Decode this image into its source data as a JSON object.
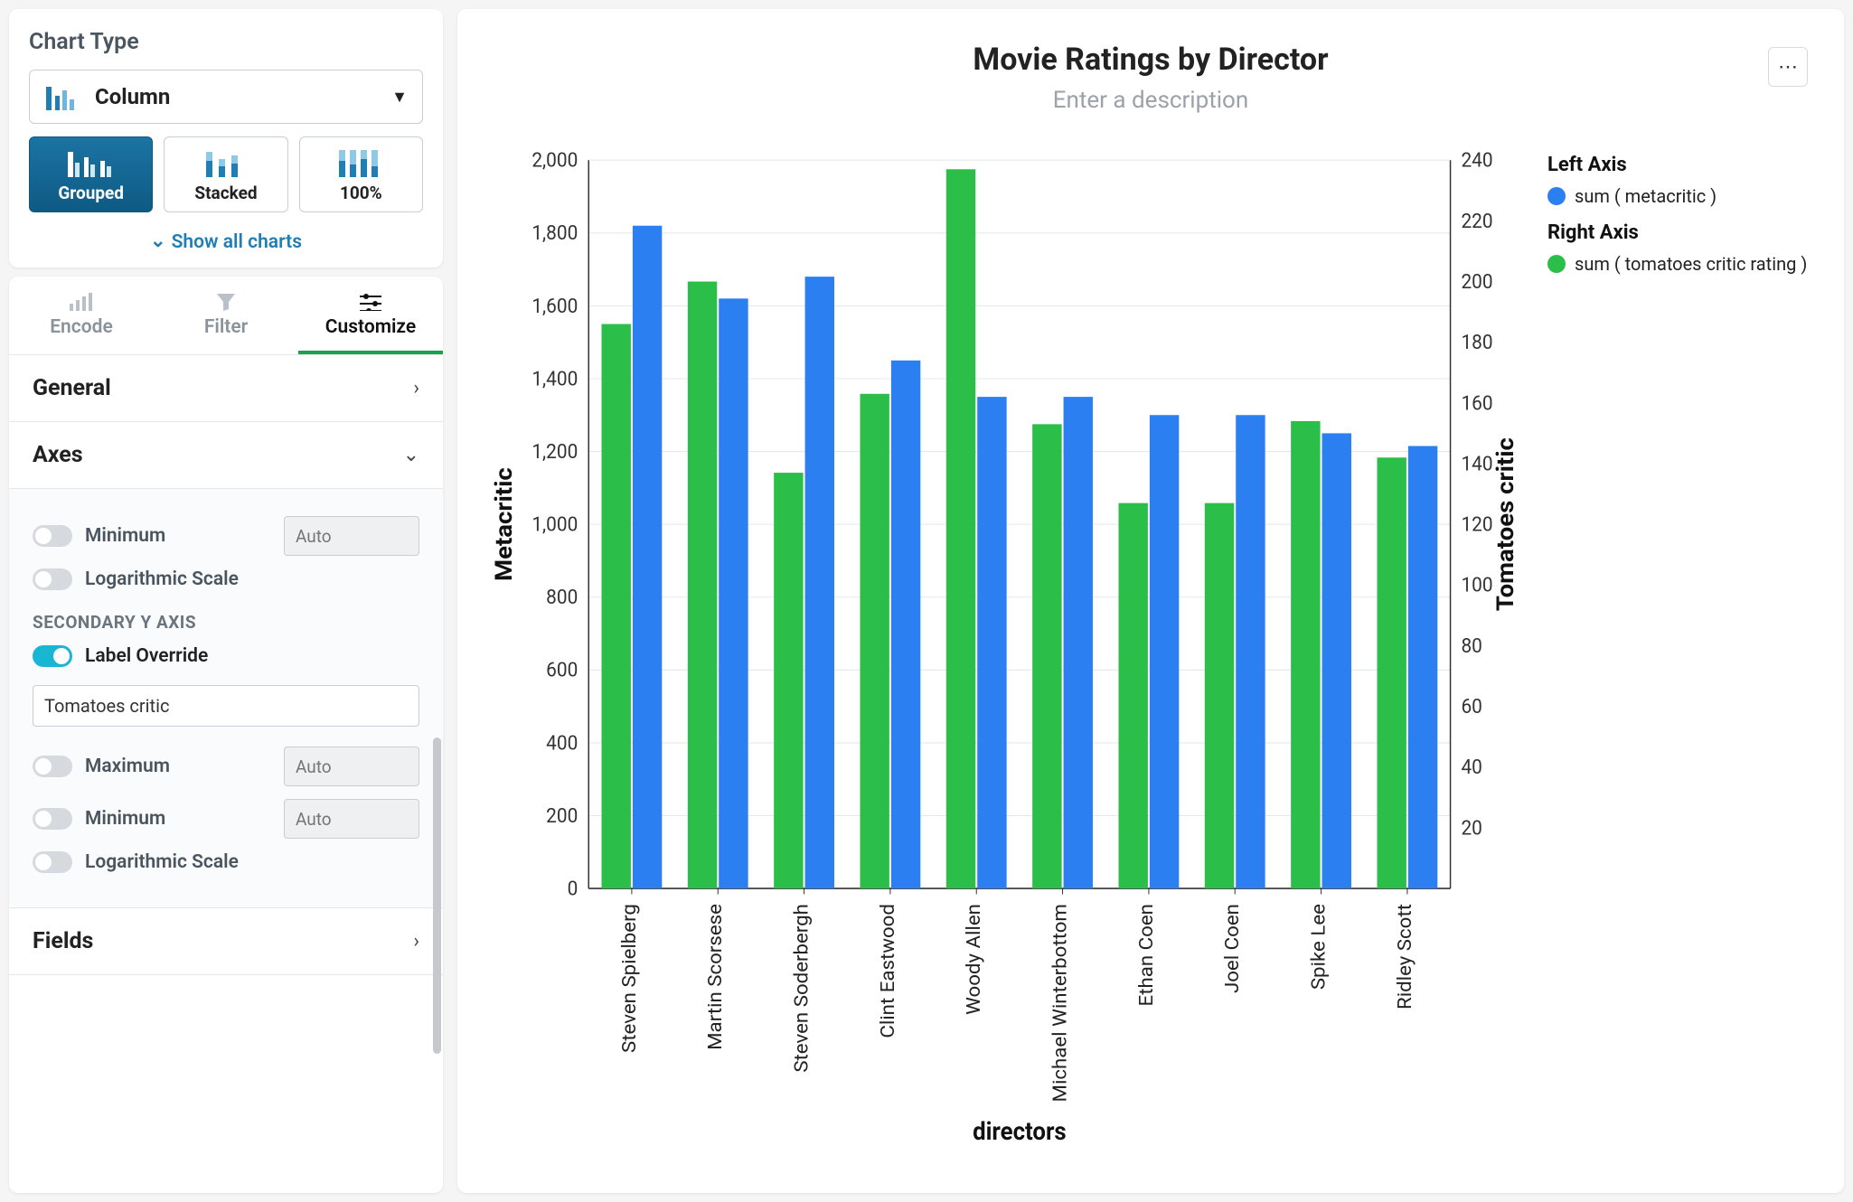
{
  "sidebar": {
    "chart_type_heading": "Chart Type",
    "dropdown_label": "Column",
    "variants": {
      "grouped": "Grouped",
      "stacked": "Stacked",
      "pct": "100%"
    },
    "show_all": "Show all charts",
    "tabs": {
      "encode": "Encode",
      "filter": "Filter",
      "customize": "Customize"
    },
    "sections": {
      "general": "General",
      "axes": "Axes",
      "fields": "Fields"
    },
    "axes": {
      "minimum": "Minimum",
      "log": "Logarithmic Scale",
      "secondary_heading": "SECONDARY Y AXIS",
      "label_override": "Label Override",
      "label_override_value": "Tomatoes critic",
      "maximum": "Maximum",
      "auto": "Auto"
    }
  },
  "chart": {
    "title": "Movie Ratings by Director",
    "description_placeholder": "Enter a description",
    "xlabel": "directors",
    "y_left_label": "Metacritic",
    "y_right_label": "Tomatoes critic",
    "legend": {
      "left_title": "Left Axis",
      "left_item": "sum ( metacritic )",
      "right_title": "Right Axis",
      "right_item": "sum ( tomatoes critic rating )"
    },
    "colors": {
      "green": "#2bbf4a",
      "blue": "#2b7ff0"
    }
  },
  "chart_data": {
    "type": "bar",
    "categories": [
      "Steven Spielberg",
      "Martin Scorsese",
      "Steven Soderbergh",
      "Clint Eastwood",
      "Woody Allen",
      "Michael Winterbottom",
      "Ethan Coen",
      "Joel Coen",
      "Spike Lee",
      "Ridley Scott"
    ],
    "series": [
      {
        "name": "sum ( tomatoes critic rating )",
        "axis": "right",
        "color": "#2bbf4a",
        "values": [
          186,
          200,
          137,
          163,
          237,
          153,
          127,
          127,
          154,
          142
        ]
      },
      {
        "name": "sum ( metacritic )",
        "axis": "left",
        "color": "#2b7ff0",
        "values": [
          1820,
          1620,
          1680,
          1450,
          1350,
          1350,
          1300,
          1300,
          1250,
          1215
        ]
      }
    ],
    "y_left": {
      "min": 0,
      "max": 2000,
      "ticks": [
        0,
        200,
        400,
        600,
        800,
        1000,
        1200,
        1400,
        1600,
        1800,
        2000
      ]
    },
    "y_right": {
      "min": 0,
      "max": 240,
      "ticks": [
        20,
        40,
        60,
        80,
        100,
        120,
        140,
        160,
        180,
        200,
        220,
        240
      ]
    },
    "title": "Movie Ratings by Director",
    "xlabel": "directors",
    "ylabel_left": "Metacritic",
    "ylabel_right": "Tomatoes critic"
  }
}
